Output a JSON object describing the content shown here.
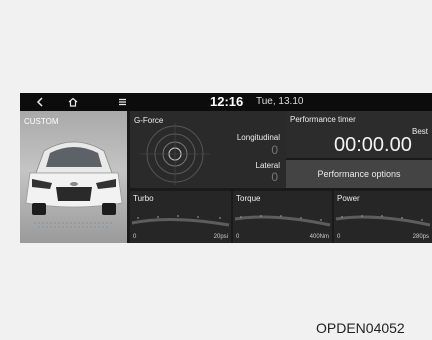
{
  "topbar": {
    "back_icon": "chevron-left-icon",
    "home_icon": "home-icon",
    "menu_icon": "menu-icon",
    "time": "12:16",
    "date": "Tue, 13.10"
  },
  "car_panel": {
    "label": "CUSTOM"
  },
  "gforce": {
    "title": "G-Force",
    "longitudinal_label": "Longitudinal",
    "longitudinal_value": "0",
    "lateral_label": "Lateral",
    "lateral_value": "0"
  },
  "performance_timer": {
    "title": "Performance timer",
    "best_label": "Best",
    "time": "00:00.00"
  },
  "performance_options": {
    "label": "Performance options"
  },
  "gauges": {
    "turbo": {
      "title": "Turbo",
      "min": "0",
      "max": "20psi"
    },
    "torque": {
      "title": "Torque",
      "min": "0",
      "max": "400Nm"
    },
    "power": {
      "title": "Power",
      "min": "0",
      "max": "280ps"
    }
  },
  "caption": "OPDEN04052",
  "colors": {
    "screen_bg": "#1a1a1a",
    "panel_bg": "#2a2a2a",
    "text": "#eaeaea",
    "page_bg": "#f1f1f1"
  }
}
